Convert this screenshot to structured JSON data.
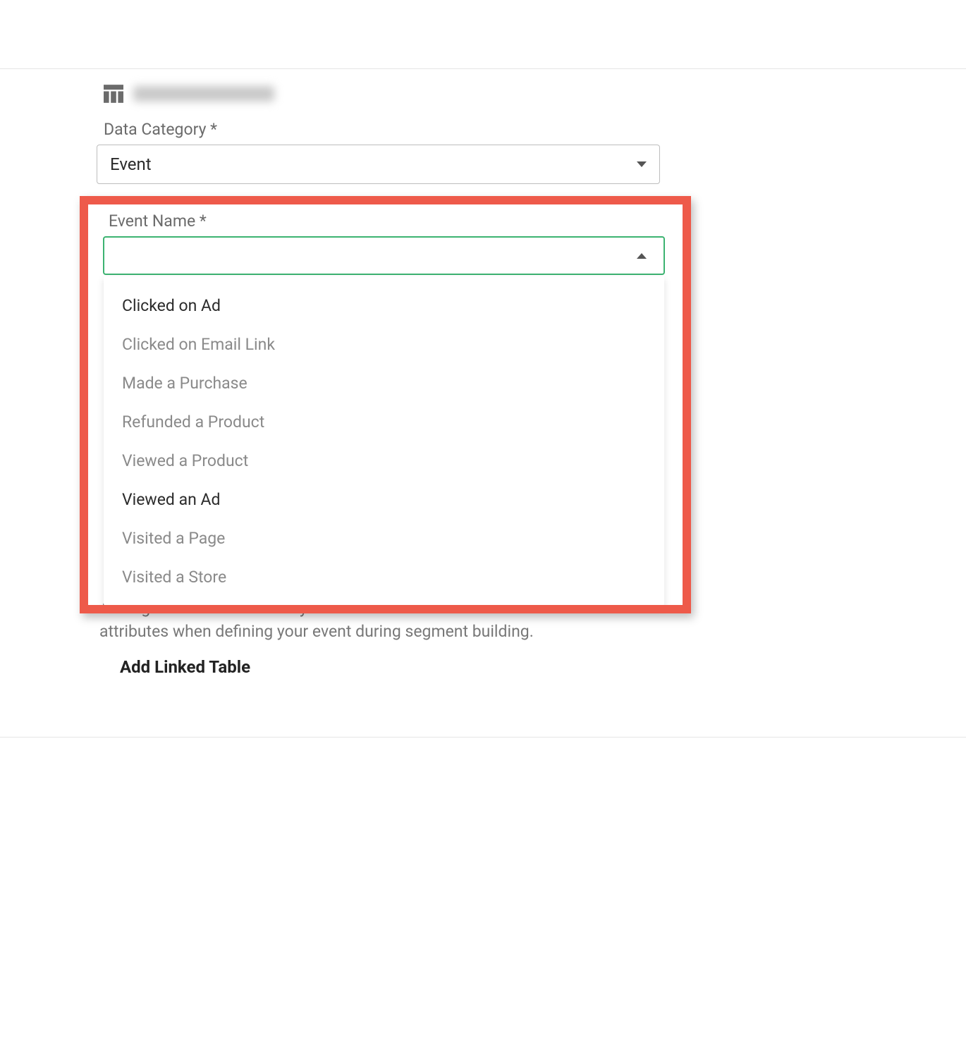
{
  "data_category": {
    "label": "Data Category *",
    "value": "Event"
  },
  "event_name": {
    "label": "Event Name *",
    "options": [
      {
        "text": "Clicked on Ad",
        "emph": true
      },
      {
        "text": "Clicked on Email Link",
        "emph": false
      },
      {
        "text": "Made a Purchase",
        "emph": false
      },
      {
        "text": "Refunded a Product",
        "emph": false
      },
      {
        "text": "Viewed a Product",
        "emph": false
      },
      {
        "text": "Viewed an Ad",
        "emph": true
      },
      {
        "text": "Visited a Page",
        "emph": false
      },
      {
        "text": "Visited a Store",
        "emph": false
      }
    ]
  },
  "linked_tables": {
    "description": "Adding linked tables allows you to use columns from those tables as attributes when defining your event during segment building.",
    "button": "Add Linked Table"
  }
}
